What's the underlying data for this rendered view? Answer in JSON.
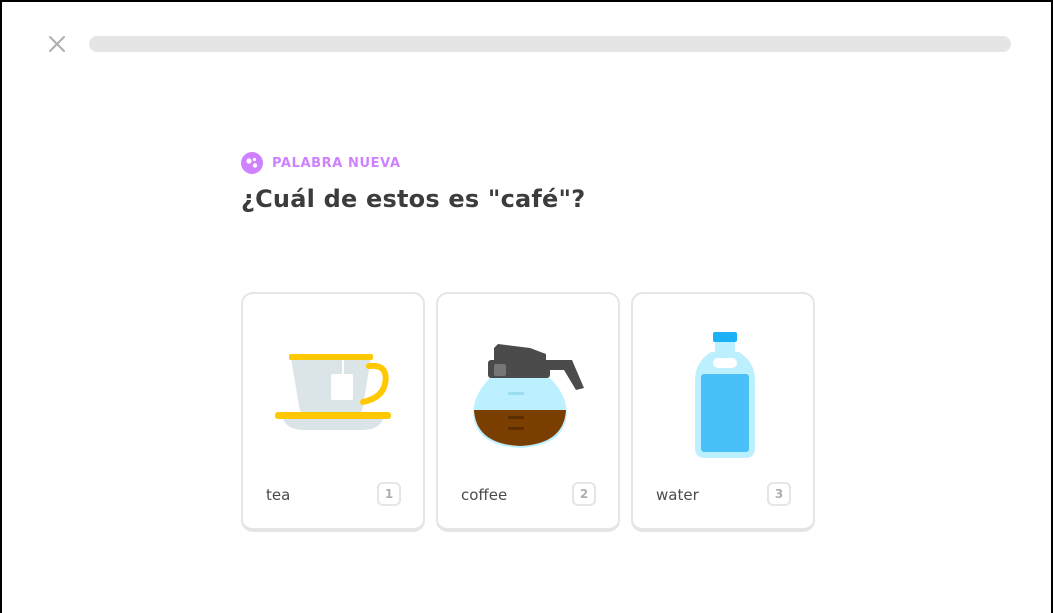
{
  "header": {
    "close_icon": "close-icon",
    "progress_fraction": 0.0
  },
  "challenge": {
    "badge_label": "PALABRA NUEVA",
    "badge_icon": "new-word-icon",
    "badge_color": "#ce82ff",
    "question": "¿Cuál de estos es \"café\"?"
  },
  "choices": [
    {
      "label": "tea",
      "key": "1",
      "icon": "teacup-icon"
    },
    {
      "label": "coffee",
      "key": "2",
      "icon": "coffee-pot-icon"
    },
    {
      "label": "water",
      "key": "3",
      "icon": "water-bottle-icon"
    }
  ],
  "colors": {
    "text": "#3c3c3c",
    "border": "#e5e5e5",
    "key_text": "#afafaf",
    "progress_track": "#e5e5e5"
  }
}
